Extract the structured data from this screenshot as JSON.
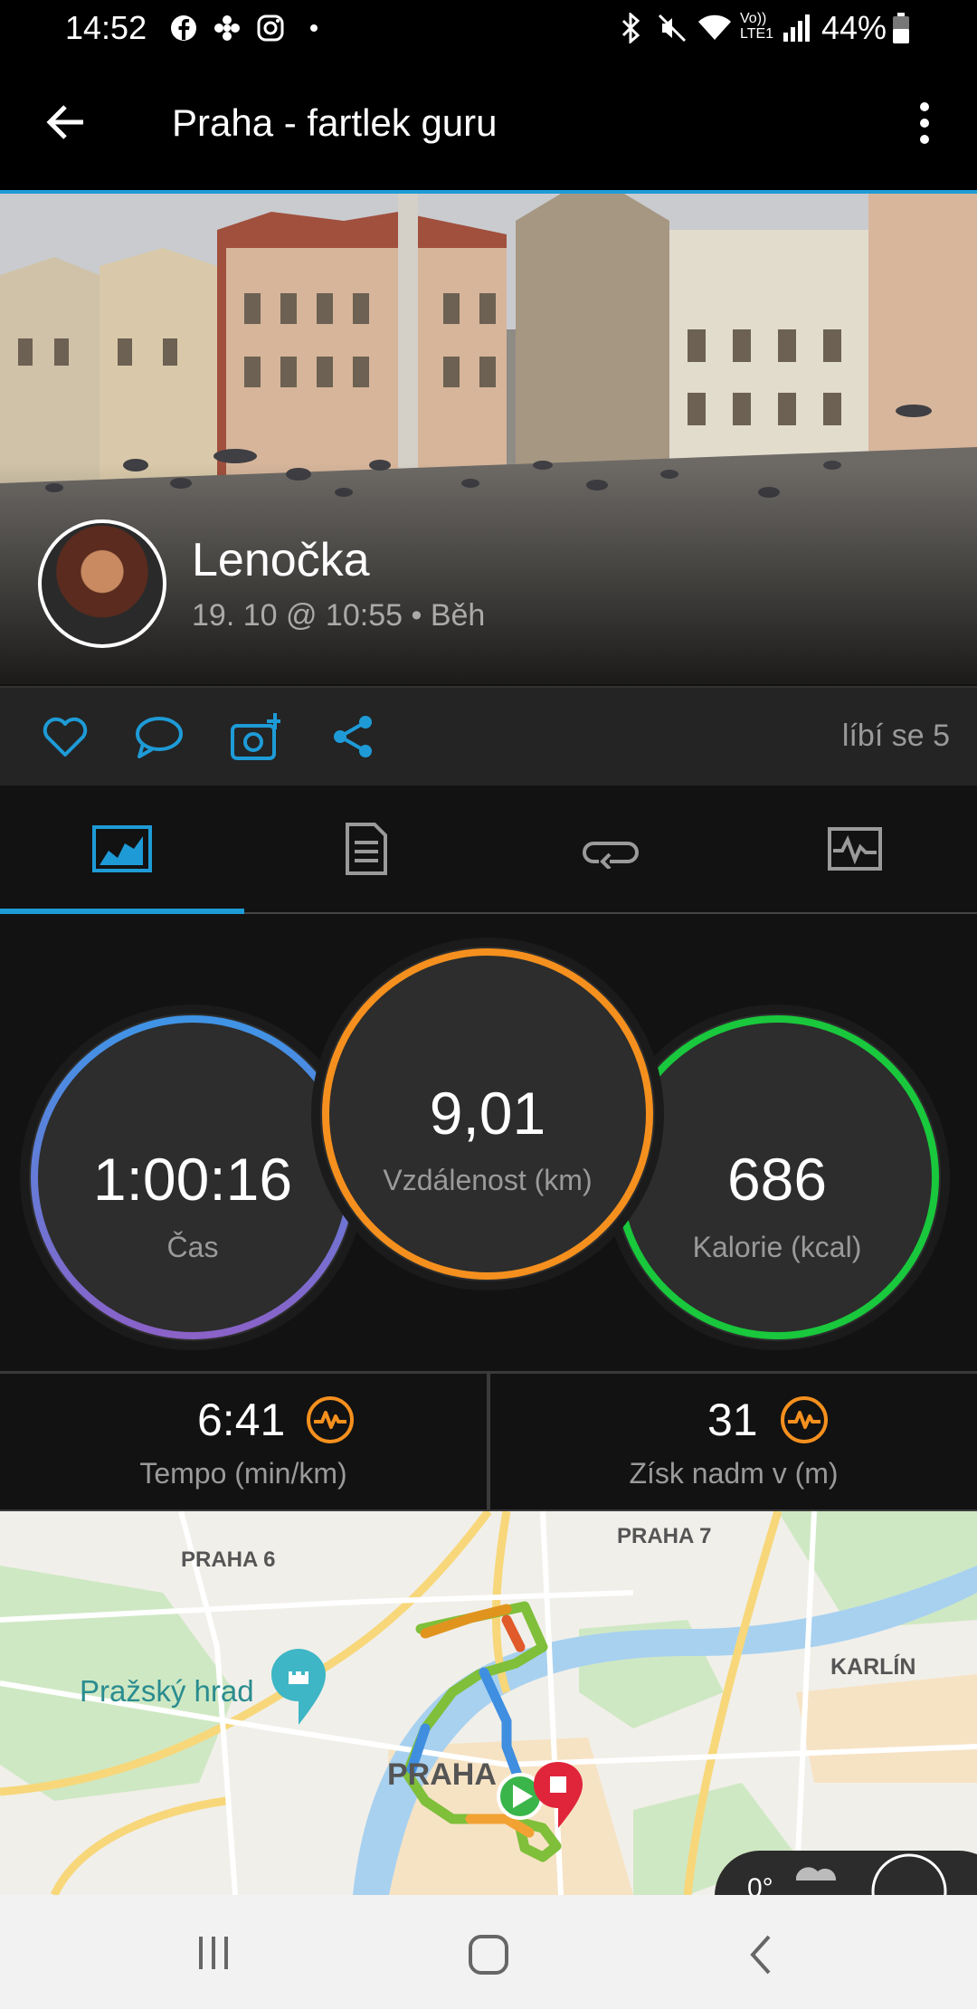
{
  "status_bar": {
    "time": "14:52",
    "battery": "44%",
    "icons": [
      "facebook-icon",
      "fan-icon",
      "instagram-icon",
      "dot-icon",
      "bluetooth-icon",
      "mute-icon",
      "wifi-icon",
      "volte-icon",
      "signal-icon",
      "battery-icon"
    ],
    "volte": "Vo)) LTE1"
  },
  "app_bar": {
    "title": "Praha - fartlek guru"
  },
  "activity": {
    "user_name": "Lenočka",
    "meta": "19. 10 @ 10:55 • Běh",
    "likes": "líbí se 5"
  },
  "tabs": [
    {
      "icon": "map-summary-icon",
      "active": true
    },
    {
      "icon": "document-icon",
      "active": false
    },
    {
      "icon": "laps-icon",
      "active": false
    },
    {
      "icon": "chart-icon",
      "active": false
    }
  ],
  "metrics": {
    "time": {
      "value": "1:00:16",
      "label": "Čas"
    },
    "distance": {
      "value": "9,01",
      "label": "Vzdálenost (km)"
    },
    "calories": {
      "value": "686",
      "label": "Kalorie (kcal)"
    }
  },
  "stats": {
    "pace": {
      "value": "6:41",
      "label": "Tempo (min/km)"
    },
    "ascent": {
      "value": "31",
      "label": "Získ nadm v (m)"
    }
  },
  "map": {
    "labels": {
      "praha6": "PRAHA 6",
      "praha7": "PRAHA 7",
      "karlin": "KARLÍN",
      "hrad": "Pražský hrad",
      "praha": "PRAHA"
    },
    "weather": "0°"
  },
  "colors": {
    "accent": "#1e9bd7",
    "ring_time": "#4a8fe0",
    "ring_distance": "#f5901e",
    "ring_calories": "#19c83c",
    "badge": "#f5901e"
  }
}
